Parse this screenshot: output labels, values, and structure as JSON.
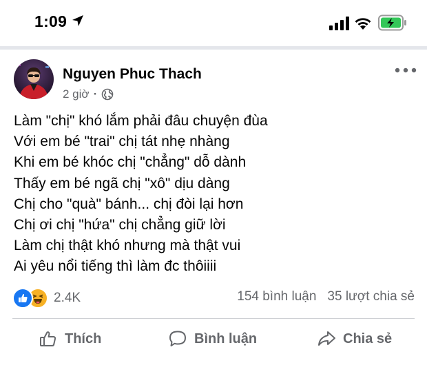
{
  "status_bar": {
    "time": "1:09"
  },
  "post": {
    "author": "Nguyen Phuc Thach",
    "time_ago": "2 giờ",
    "privacy_icon": "globe-icon",
    "lines": [
      "Làm \"chị\" khó lắm phải đâu chuyện đùa",
      "Với em bé \"trai\" chị tát nhẹ nhàng",
      "Khi em bé khóc chị \"chẳng\" dỗ dành",
      "Thấy em bé ngã chị \"xô\" dịu dàng",
      "Chị cho \"quà\" bánh... chị đòi lại hơn",
      "Chị ơi chị \"hứa\" chị chẳng giữ lời",
      "Làm chị thật khó nhưng mà thật vui",
      "Ai yêu nổi tiếng thì làm đc thôiiii"
    ],
    "reactions_count": "2.4K",
    "comments": "154 bình luận",
    "shares": "35 lượt chia sẻ"
  },
  "actions": {
    "like": "Thích",
    "comment": "Bình luận",
    "share": "Chia sẻ"
  },
  "colors": {
    "like_blue": "#1877f2",
    "haha_yellow": "#f7b125",
    "secondary_text": "#65676b",
    "battery_green": "#34c759"
  }
}
